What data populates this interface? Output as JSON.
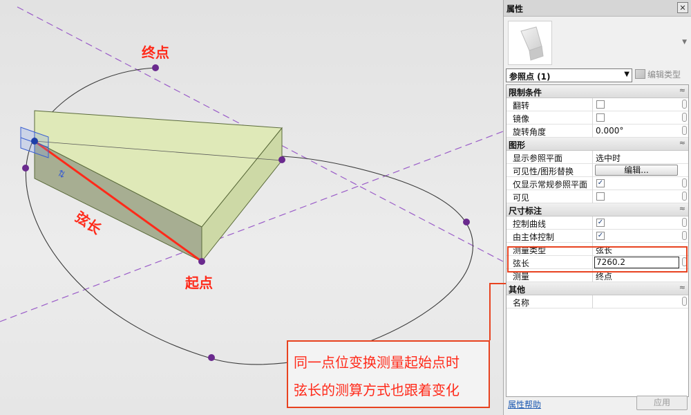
{
  "viewport": {
    "labels": {
      "end_point": "终点",
      "start_point": "起点",
      "chord": "弦长"
    },
    "callout": {
      "line1": "同一点位变换测量起始点时",
      "line2": "弦长的测算方式也跟着变化"
    },
    "colors": {
      "annotation_red": "#ff2a1a",
      "ref_point": "#6a2a8e",
      "solid_face": "#dfe9b8",
      "guide_line": "#9a5cc8"
    }
  },
  "panel": {
    "title": "属性",
    "close_icon": "close-icon",
    "type_selector": "参照点 (1)",
    "edit_type": "编辑类型",
    "groups": [
      {
        "title": "限制条件",
        "rows": [
          {
            "name": "翻转",
            "checked": false
          },
          {
            "name": "镜像",
            "checked": false
          },
          {
            "name": "旋转角度",
            "value": "0.000°"
          }
        ]
      },
      {
        "title": "图形",
        "rows": [
          {
            "name": "显示参照平面",
            "value": "选中时"
          },
          {
            "name": "可见性/图形替换",
            "button": "编辑..."
          },
          {
            "name": "仅显示常规参照平面",
            "checked": true
          },
          {
            "name": "可见",
            "checked": false
          }
        ]
      },
      {
        "title": "尺寸标注",
        "rows": [
          {
            "name": "控制曲线",
            "checked": true
          },
          {
            "name": "由主体控制",
            "checked": true
          },
          {
            "name": "测量类型",
            "value": "弦长"
          },
          {
            "name": "弦长",
            "value": "7260.2"
          },
          {
            "name": "测量",
            "value": "终点"
          }
        ]
      },
      {
        "title": "其他",
        "rows": [
          {
            "name": "名称",
            "value": ""
          }
        ]
      }
    ],
    "help_link": "属性帮助",
    "apply": "应用"
  }
}
